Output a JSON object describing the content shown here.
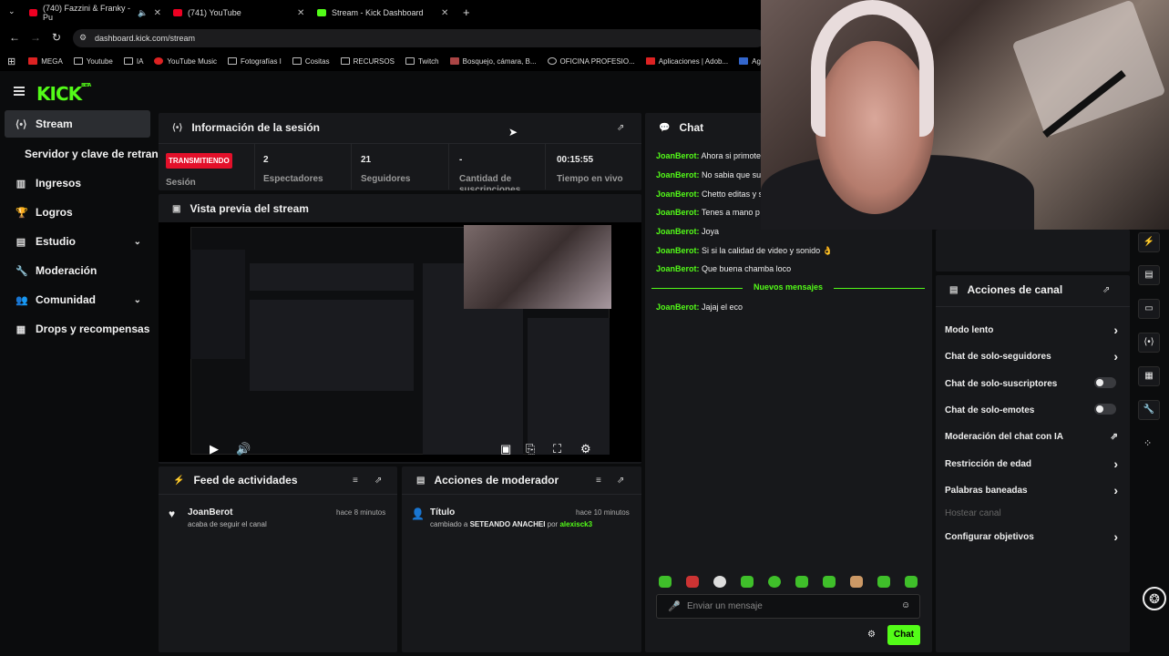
{
  "browser": {
    "tabs": [
      {
        "label": "(740) Fazzini & Franky - Pu"
      },
      {
        "label": "(741) YouTube"
      },
      {
        "label": "Stream - Kick Dashboard"
      }
    ],
    "url": "dashboard.kick.com/stream",
    "bookmarks": [
      "MEGA",
      "Youtube",
      "IA",
      "YouTube Music",
      "Fotografías I",
      "Cositas",
      "RECURSOS",
      "Twitch",
      "Bosquejo, cámara, B...",
      "OFICINA PROFESIO...",
      "Aplicaciones | Adob...",
      "Ag"
    ]
  },
  "app": {
    "logo": "KICK",
    "logo_tag": "BETA"
  },
  "sidebar": {
    "items": [
      {
        "label": "Stream",
        "icon": "broadcast-icon"
      },
      {
        "label": "Servidor y clave de retransm",
        "icon": ""
      },
      {
        "label": "Ingresos",
        "icon": "chart-icon"
      },
      {
        "label": "Logros",
        "icon": "trophy-icon"
      },
      {
        "label": "Estudio",
        "icon": "studio-icon"
      },
      {
        "label": "Moderación",
        "icon": "wrench-icon"
      },
      {
        "label": "Comunidad",
        "icon": "users-icon"
      },
      {
        "label": "Drops y recompensas",
        "icon": "gift-icon"
      }
    ]
  },
  "session": {
    "title": "Información de la sesión",
    "badge": "TRANSMITIENDO",
    "session_label": "Sesión",
    "stats": [
      {
        "value": "2",
        "label": "Espectadores"
      },
      {
        "value": "21",
        "label": "Seguidores"
      },
      {
        "value": "-",
        "label": "Cantidad de suscripciones"
      },
      {
        "value": "00:15:55",
        "label": "Tiempo en vivo"
      }
    ]
  },
  "preview": {
    "title": "Vista previa del stream"
  },
  "feed": {
    "title": "Feed de actividades",
    "user": "JoanBerot",
    "time": "hace 8 minutos",
    "text": "acaba de seguir el canal"
  },
  "modactions": {
    "title": "Acciones de moderador",
    "item_title": "Título",
    "time": "hace 10 minutos",
    "pre": "cambiado a",
    "value": "SETEANDO ANACHEI",
    "by": "por",
    "mod": "alexisck3"
  },
  "chat": {
    "title": "Chat",
    "messages": [
      {
        "user": "JoanBerot:",
        "text": "Ahora si primote"
      },
      {
        "user": "JoanBerot:",
        "text": "No sabia que su"
      },
      {
        "user": "JoanBerot:",
        "text": "Chetto editas y s"
      },
      {
        "user": "JoanBerot:",
        "text": "Tenes a mano p"
      },
      {
        "user": "JoanBerot:",
        "text": "Joya"
      },
      {
        "user": "JoanBerot:",
        "text": "Si si la calidad de video y sonido 👌"
      },
      {
        "user": "JoanBerot:",
        "text": "Que buena chamba loco"
      }
    ],
    "new_messages": "Nuevos mensajes",
    "after": [
      {
        "user": "JoanBerot:",
        "text": "Jajaj el eco"
      }
    ],
    "placeholder": "Enviar un mensaje",
    "send": "Chat"
  },
  "channel_actions": {
    "title": "Acciones de canal",
    "items": [
      {
        "label": "Modo lento",
        "control": "chevron"
      },
      {
        "label": "Chat de solo-seguidores",
        "control": "chevron"
      },
      {
        "label": "Chat de solo-suscriptores",
        "control": "toggle"
      },
      {
        "label": "Chat de solo-emotes",
        "control": "toggle"
      },
      {
        "label": "Moderación del chat con IA",
        "control": "external"
      },
      {
        "label": "Restricción de edad",
        "control": "chevron"
      },
      {
        "label": "Palabras baneadas",
        "control": "chevron"
      },
      {
        "label": "Hostear canal",
        "control": "none"
      },
      {
        "label": "Configurar objetivos",
        "control": "chevron"
      }
    ]
  },
  "colors": {
    "brand": "#53fc18",
    "live": "#e3102a"
  }
}
